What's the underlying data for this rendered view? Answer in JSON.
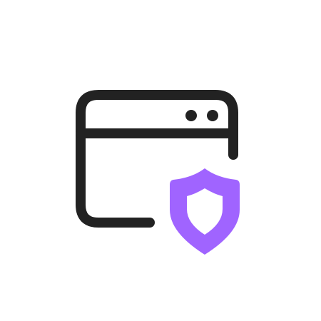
{
  "icon": {
    "name": "browser-window-shield-icon",
    "parts": [
      "browser-window-icon",
      "window-dots-icon",
      "shield-icon"
    ]
  },
  "colors": {
    "background": "#ffffff",
    "window_stroke": "#222222",
    "shield_fill": "#A064FF",
    "shield_inner": "#ffffff"
  }
}
